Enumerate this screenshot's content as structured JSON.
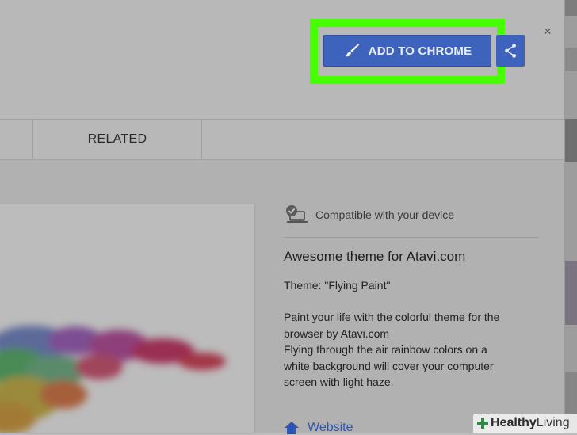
{
  "header": {
    "add_button_label": "ADD TO CHROME",
    "close_symbol": "×"
  },
  "tabs": [
    {
      "label": ""
    },
    {
      "label": "RELATED"
    }
  ],
  "details": {
    "compatibility": "Compatible with your device",
    "title": "Awesome theme for Atavi.com",
    "theme_line": "Theme: \"Flying Paint\"",
    "description_lines": [
      "Paint your life with the colorful theme for the",
      "browser by Atavi.com",
      "Flying through the air rainbow colors on a",
      "white background will cover your computer",
      "screen with light haze."
    ],
    "website_label": "Website"
  },
  "watermark": {
    "bold": "Healthy",
    "light": "Living"
  },
  "colors": {
    "highlight": "#46ff00",
    "button": "#3e63bd",
    "link": "#2e55b0"
  },
  "icons": [
    "brush-icon",
    "share-icon",
    "close-icon",
    "device-check-icon",
    "home-icon",
    "plus-leaf-icon"
  ]
}
